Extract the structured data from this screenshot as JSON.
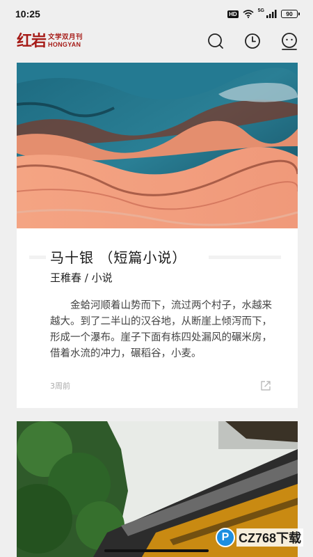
{
  "status_bar": {
    "time": "10:25",
    "hd_badge": "HD",
    "network": "5G",
    "battery": "90"
  },
  "header": {
    "logo_mark": "红岩",
    "logo_cn": "文学双月刊",
    "logo_en": "HONGYAN",
    "icons": [
      "search-icon",
      "clock-icon",
      "profile-icon"
    ],
    "brand_color": "#a61b17"
  },
  "articles": [
    {
      "title": "马十银 （短篇小说）",
      "author": "王稚春 / 小说",
      "excerpt": "金蛤河顺着山势而下，流过两个村子，水越来越大。到了二半山的汉谷地，从断崖上倾泻而下，形成一个瀑布。崖子下面有栋四处漏风的碾米房，借着水流的冲力，碾稻谷，小麦。",
      "time": "3周前",
      "share_icon": "share-icon"
    }
  ],
  "watermark": {
    "symbol": "P",
    "text": "CZ768下载"
  }
}
